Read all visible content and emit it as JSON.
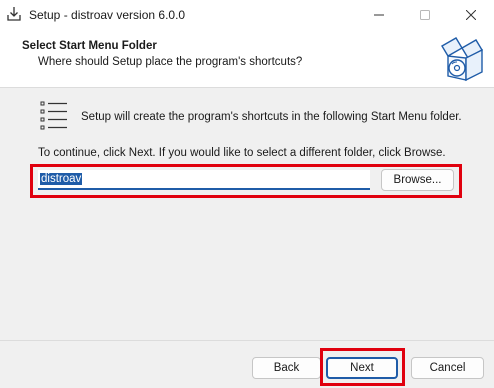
{
  "window": {
    "title": "Setup - distroav version 6.0.0",
    "icon": "installer-icon",
    "controls": [
      "minimize-icon",
      "maximize-icon",
      "close-icon"
    ]
  },
  "header": {
    "title": "Select Start Menu Folder",
    "subtitle": "Where should Setup place the program's shortcuts?",
    "icon": "setup-box-icon"
  },
  "body": {
    "info_text": "Setup will create the program's shortcuts in the following Start Menu folder.",
    "instruction_text": "To continue, click Next. If you would like to select a different folder, click Browse.",
    "folder_input_value": "distroav",
    "browse_label": "Browse..."
  },
  "footer": {
    "back_label": "Back",
    "next_label": "Next",
    "cancel_label": "Cancel"
  },
  "colors": {
    "highlight": "#e0000e",
    "accent": "#1f5ca8"
  }
}
